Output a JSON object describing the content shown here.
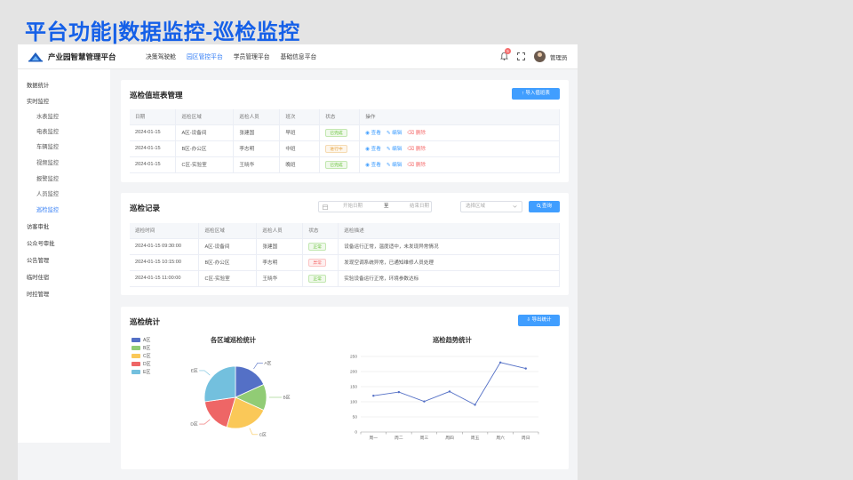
{
  "slide": {
    "title": "平台功能|数据监控-巡检监控"
  },
  "app": {
    "name": "产业园智慧管理平台"
  },
  "nav": [
    {
      "label": "决策驾驶舱",
      "active": false
    },
    {
      "label": "园区管控平台",
      "active": true
    },
    {
      "label": "学员管理平台",
      "active": false
    },
    {
      "label": "基础信息平台",
      "active": false
    }
  ],
  "header": {
    "badge_count": "5",
    "user_name": "管理员"
  },
  "sidebar": [
    {
      "label": "数据统计",
      "sub": false,
      "active": false
    },
    {
      "label": "实时监控",
      "sub": false,
      "active": false
    },
    {
      "label": "水表监控",
      "sub": true,
      "active": false
    },
    {
      "label": "电表监控",
      "sub": true,
      "active": false
    },
    {
      "label": "车辆监控",
      "sub": true,
      "active": false
    },
    {
      "label": "视频监控",
      "sub": true,
      "active": false
    },
    {
      "label": "报警监控",
      "sub": true,
      "active": false
    },
    {
      "label": "人员监控",
      "sub": true,
      "active": false
    },
    {
      "label": "巡检监控",
      "sub": true,
      "active": true
    },
    {
      "label": "访客审批",
      "sub": false,
      "active": false
    },
    {
      "label": "公众号审批",
      "sub": false,
      "active": false
    },
    {
      "label": "公告管理",
      "sub": false,
      "active": false
    },
    {
      "label": "临时住宿",
      "sub": false,
      "active": false
    },
    {
      "label": "时控管理",
      "sub": false,
      "active": false
    }
  ],
  "duty": {
    "title": "巡检值班表管理",
    "import_label": "↑ 导入值班表",
    "columns": [
      "日期",
      "巡检区域",
      "巡检人员",
      "班次",
      "状态",
      "操作"
    ],
    "rows": [
      {
        "date": "2024-01-15",
        "area": "A区-设备间",
        "person": "张建国",
        "shift": "早班",
        "status": "已完成"
      },
      {
        "date": "2024-01-15",
        "area": "B区-办公区",
        "person": "李志明",
        "shift": "中班",
        "status": "进行中"
      },
      {
        "date": "2024-01-15",
        "area": "C区-实验室",
        "person": "王晓华",
        "shift": "晚班",
        "status": "已完成"
      }
    ],
    "ops": {
      "view": "查看",
      "edit": "编辑",
      "delete": "删除"
    }
  },
  "records": {
    "title": "巡检记录",
    "start_placeholder": "开始日期",
    "to_label": "至",
    "end_placeholder": "结束日期",
    "area_placeholder": "选择区域",
    "query_label": "查询",
    "columns": [
      "巡检时间",
      "巡检区域",
      "巡检人员",
      "状态",
      "巡检描述"
    ],
    "rows": [
      {
        "time": "2024-01-15 09:30:00",
        "area": "A区-设备间",
        "person": "张建国",
        "status": "正常",
        "desc": "设备运行正常，温度适中，未发现异常情况"
      },
      {
        "time": "2024-01-15 10:15:00",
        "area": "B区-办公区",
        "person": "李志明",
        "status": "异常",
        "desc": "发现空调系统异常，已通知维修人员处理"
      },
      {
        "time": "2024-01-15 11:00:00",
        "area": "C区-实验室",
        "person": "王晓华",
        "status": "正常",
        "desc": "实验设备运行正常，环境参数达标"
      }
    ]
  },
  "stats": {
    "title": "巡检统计",
    "export_label": "⇩ 导出统计"
  },
  "chart_data": [
    {
      "type": "pie",
      "title": "各区域巡检统计",
      "categories": [
        "A区",
        "B区",
        "C区",
        "D区",
        "E区"
      ],
      "values": [
        20,
        15,
        25,
        20,
        30
      ],
      "colors": [
        "#5470c6",
        "#91cc75",
        "#fac858",
        "#ee6666",
        "#73c0de"
      ],
      "legend": "left"
    },
    {
      "type": "line",
      "title": "巡检趋势统计",
      "categories": [
        "周一",
        "周二",
        "周三",
        "周四",
        "周五",
        "周六",
        "周日"
      ],
      "values": [
        120,
        132,
        101,
        134,
        90,
        230,
        210
      ],
      "ylim": [
        0,
        250
      ],
      "yticks": [
        0,
        50,
        100,
        150,
        200,
        250
      ],
      "color": "#5470c6",
      "grid": true
    }
  ]
}
